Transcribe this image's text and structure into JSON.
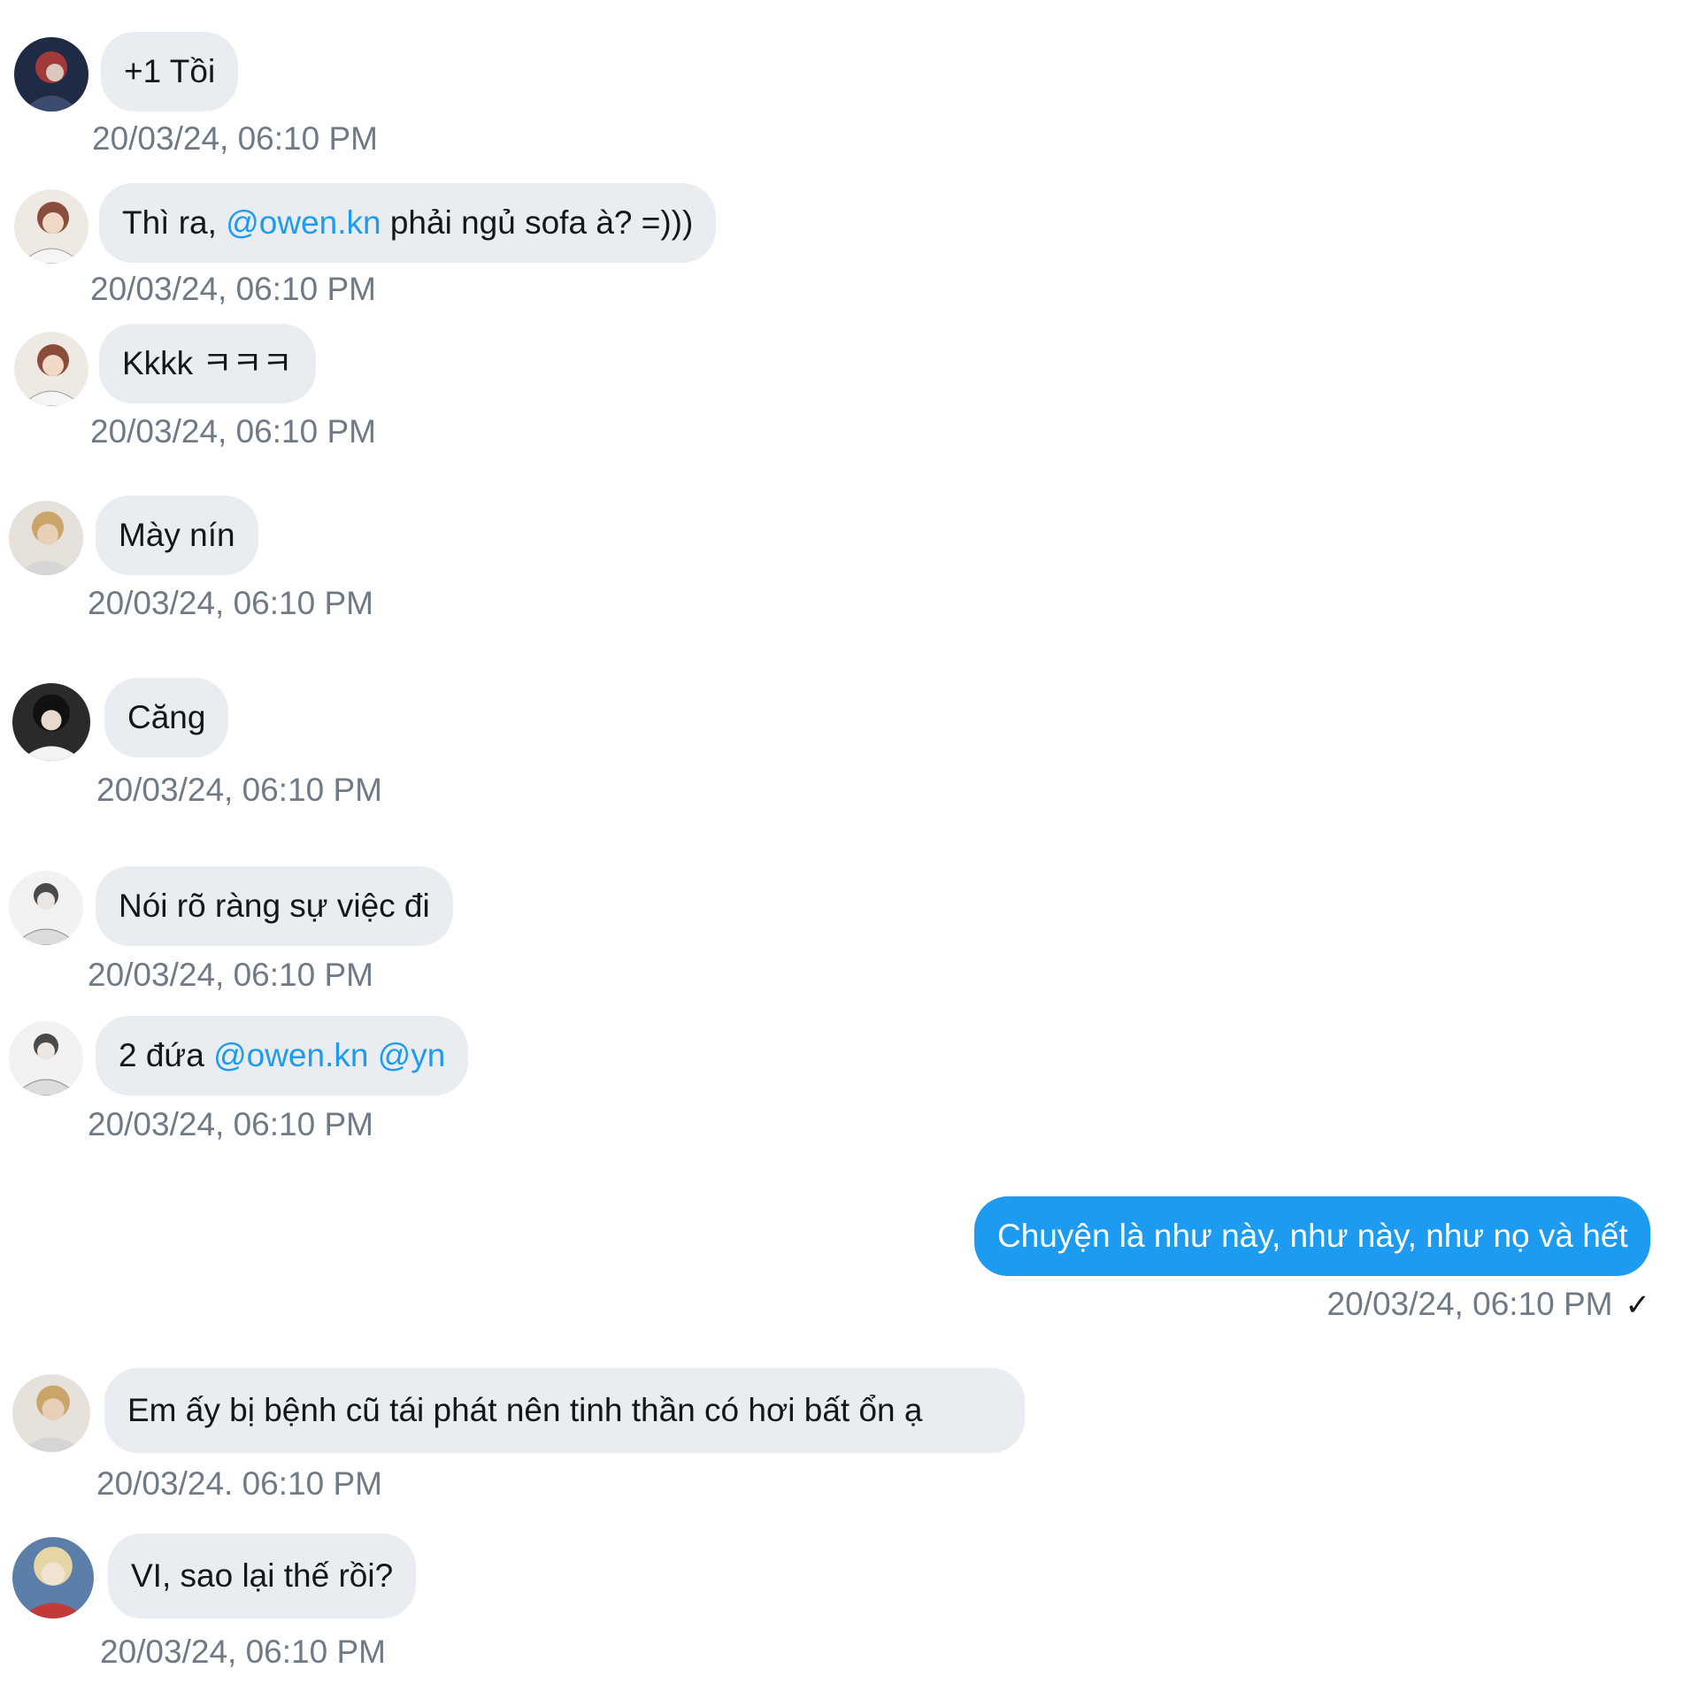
{
  "messages": [
    {
      "text": "+1 Tồi",
      "timestamp": "20/03/24, 06:10 PM",
      "avatar": "avatar-red-hair"
    },
    {
      "before": "Thì ra, ",
      "mention": "@owen.kn",
      "after": " phải ngủ sofa à? =)))",
      "timestamp": "20/03/24, 06:10 PM",
      "avatar": "avatar-brown-hair"
    },
    {
      "text": "Kkkk ㅋㅋㅋ",
      "timestamp": "20/03/24, 06:10 PM",
      "avatar": "avatar-brown-hair"
    },
    {
      "text": "Mày nín",
      "timestamp": "20/03/24, 06:10 PM",
      "avatar": "avatar-blond-hand"
    },
    {
      "text": "Căng",
      "timestamp": "20/03/24, 06:10 PM",
      "avatar": "avatar-dark-hair"
    },
    {
      "text": "Nói rõ ràng sự việc đi",
      "timestamp": "20/03/24, 06:10 PM",
      "avatar": "avatar-sketch-man"
    },
    {
      "before": "2 đứa ",
      "mentions": "@owen.kn @yn",
      "timestamp": "20/03/24, 06:10 PM",
      "avatar": "avatar-sketch-man"
    },
    {
      "text": "Chuyện là như này, như này, như nọ và hết",
      "timestamp": "20/03/24, 06:10 PM",
      "status_icon": "✓",
      "outgoing": true
    },
    {
      "text": "Em ấy bị bệnh cũ tái phát nên tinh thần có hơi bất ổn ạ",
      "timestamp": "20/03/24. 06:10 PM",
      "avatar": "avatar-blond-hand"
    },
    {
      "text": "VI, sao lại thế rồi?",
      "timestamp": "20/03/24, 06:10 PM",
      "avatar": "avatar-blonde-woman"
    }
  ],
  "colors": {
    "incoming_bubble": "#e9ecf0",
    "outgoing_bubble": "#1d9bf0",
    "mention": "#1d9bf0",
    "timestamp": "#6f7a86"
  }
}
